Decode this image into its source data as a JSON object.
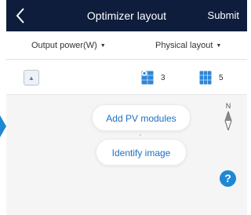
{
  "header": {
    "title": "Optimizer layout",
    "submit_label": "Submit"
  },
  "toolbar": {
    "output_power_label": "Output power(W)",
    "physical_layout_label": "Physical layout",
    "caret": "▼"
  },
  "modules": {
    "expand_icon": "chevron-up",
    "count_a": "3",
    "count_b": "5"
  },
  "canvas": {
    "add_pv_label": "Add PV modules",
    "identify_label": "Identify image",
    "compass_label": "N",
    "help_label": "?"
  },
  "colors": {
    "header_bg": "#0e1d3c",
    "accent": "#1e88d4",
    "link_text": "#1d6fc6"
  }
}
